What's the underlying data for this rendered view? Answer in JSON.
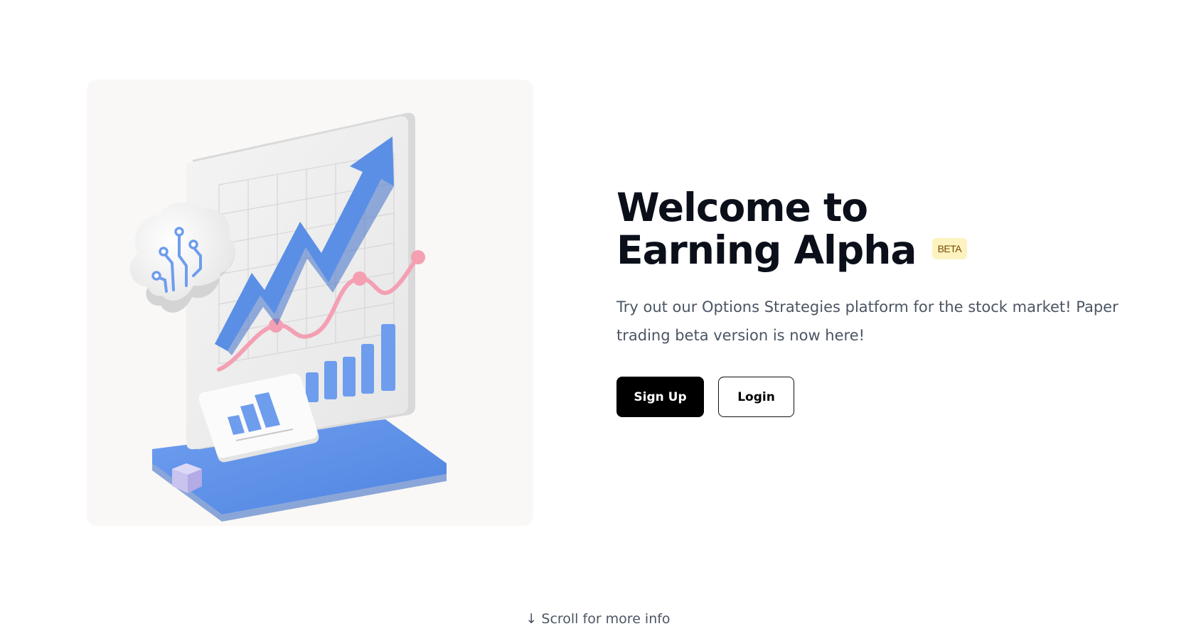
{
  "hero": {
    "illustration_icon": "growth-chart-illustration",
    "colors": {
      "card_bg": "#f9f8f6",
      "accent_blue": "#5b8fe6",
      "accent_pink": "#f5a3b5",
      "accent_lavender": "#c9c3f0"
    }
  },
  "heading": {
    "line1": "Welcome to",
    "line2": "Earning Alpha",
    "badge": "BETA"
  },
  "description": "Try out our Options Strategies platform for the stock market! Paper trading beta version is now here!",
  "buttons": {
    "signup_label": "Sign Up",
    "login_label": "Login"
  },
  "scroll_hint": "↓ Scroll for more info"
}
